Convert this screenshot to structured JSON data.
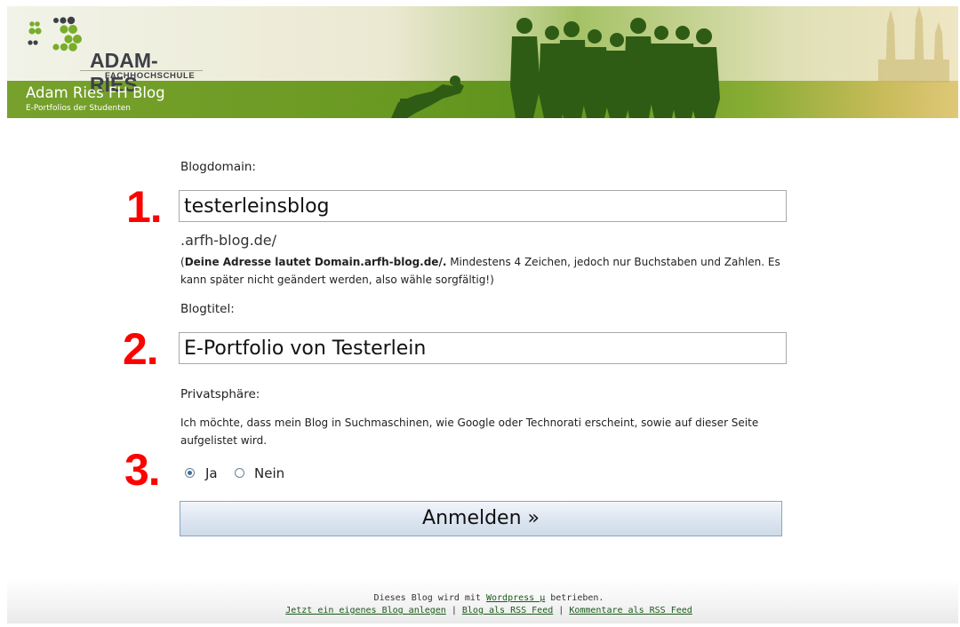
{
  "header": {
    "logo_name": "ADAM-RIES",
    "logo_subtitle": "FACHHOCHSCHULE",
    "blog_title": "Adam Ries FH Blog",
    "blog_subtitle": "E-Portfolios der Studenten"
  },
  "form": {
    "domain": {
      "label": "Blogdomain:",
      "step": "1.",
      "value": "testerleinsblog",
      "suffix": ".arfh-blog.de/",
      "hint_bold": "Deine Adresse lautet Domain.arfh-blog.de/.",
      "hint_open": "(",
      "hint_rest": " Mindestens 4 Zeichen, jedoch nur Buchstaben und Zahlen. Es kann später nicht geändert werden, also wähle sorgfältig!)"
    },
    "title": {
      "label": "Blogtitel:",
      "step": "2.",
      "value": "E-Portfolio von Testerlein"
    },
    "privacy": {
      "label": "Privatsphäre:",
      "step": "3.",
      "text": "Ich möchte, dass mein Blog in Suchmaschinen, wie Google oder Technorati erscheint, sowie auf dieser Seite aufgelistet wird.",
      "options": [
        {
          "label": "Ja",
          "checked": true
        },
        {
          "label": "Nein",
          "checked": false
        }
      ]
    },
    "submit_label": "Anmelden »"
  },
  "footer": {
    "line1_pre": "Dieses Blog wird mit ",
    "line1_link": "Wordpress µ",
    "line1_post": " betrieben.",
    "links": [
      "Jetzt ein eigenes Blog anlegen",
      "Blog als RSS Feed",
      "Kommentare als RSS Feed"
    ],
    "separator": " | "
  },
  "colors": {
    "step_number": "#ff0000",
    "header_green": "#6b9a23",
    "footer_link": "#1a5a1a"
  }
}
